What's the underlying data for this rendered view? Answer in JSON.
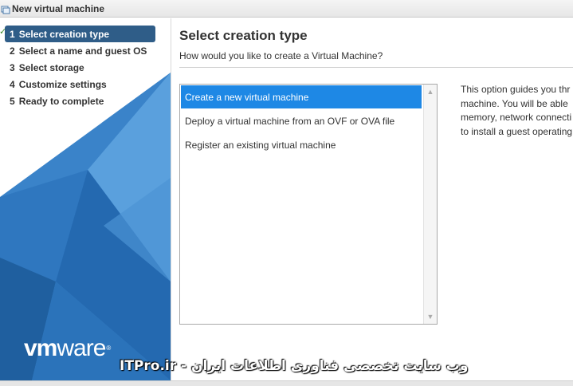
{
  "window": {
    "title": "New virtual machine"
  },
  "steps": [
    {
      "num": "1",
      "label": "Select creation type",
      "state": "active",
      "completed": true
    },
    {
      "num": "2",
      "label": "Select a name and guest OS"
    },
    {
      "num": "3",
      "label": "Select storage"
    },
    {
      "num": "4",
      "label": "Customize settings"
    },
    {
      "num": "5",
      "label": "Ready to complete"
    }
  ],
  "main": {
    "title": "Select creation type",
    "subtitle": "How would you like to create a Virtual Machine?",
    "options": [
      {
        "label": "Create a new virtual machine",
        "selected": true
      },
      {
        "label": "Deploy a virtual machine from an OVF or OVA file"
      },
      {
        "label": "Register an existing virtual machine"
      }
    ],
    "description_lines": [
      "This option guides you thr",
      "machine. You will be able",
      "memory, network connecti",
      "to install a guest operating"
    ]
  },
  "branding": {
    "logo_vm": "vm",
    "logo_ware": "ware",
    "logo_reg": "®",
    "watermark": "ITPro.ir - وب سایت تخصصی فناوری اطلاعات ایران"
  },
  "colors": {
    "active_step": "#2f5d88",
    "selected_item": "#1e88e5",
    "sidebar_blue": "#2a6db4"
  }
}
